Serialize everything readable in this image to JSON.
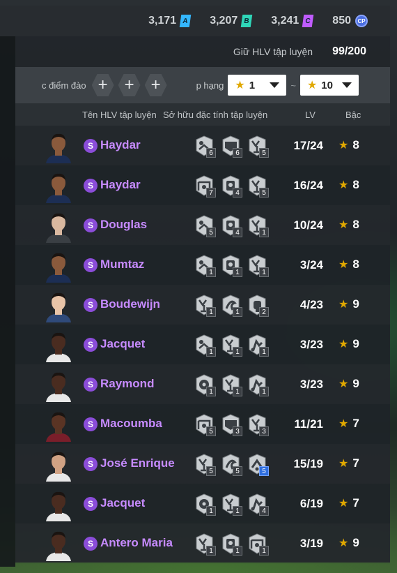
{
  "currencies": [
    {
      "value": "3,171",
      "badge": "A",
      "color": "#34b7ff",
      "icon": "a-currency-icon"
    },
    {
      "value": "3,207",
      "badge": "B",
      "color": "#2fd6b8",
      "icon": "b-currency-icon"
    },
    {
      "value": "3,241",
      "badge": "C",
      "color": "#c05cff",
      "icon": "c-currency-icon"
    },
    {
      "value": "850",
      "badge": "CP",
      "color": "#4c6fe0",
      "icon": "cp-currency-icon"
    }
  ],
  "hold": {
    "label": "Giữ HLV tập luyện",
    "value": "99/200"
  },
  "filters": {
    "trait_label": "c điểm đào",
    "rank_label": "p hạng",
    "rank_from": "1",
    "rank_to": "10",
    "tilde": "~"
  },
  "columns": {
    "name": "Tên HLV tập luyện",
    "traits": "Sở hữu đặc tính tập luyện",
    "lv": "LV",
    "grade": "Bậc"
  },
  "rows": [
    {
      "name": "Haydar",
      "lv": "17/24",
      "grade": "8",
      "skin": "#8a5a3c",
      "kit": "#1c2e54",
      "traits": [
        {
          "icon": "heading-trait-icon",
          "n": "6"
        },
        {
          "icon": "shield-trait-icon",
          "n": "6"
        },
        {
          "icon": "celebrate-trait-icon",
          "n": "5"
        }
      ]
    },
    {
      "name": "Haydar",
      "lv": "16/24",
      "grade": "8",
      "skin": "#8a5a3c",
      "kit": "#1c2e54",
      "traits": [
        {
          "icon": "goal-trait-icon",
          "n": "7"
        },
        {
          "icon": "save-trait-icon",
          "n": "4"
        },
        {
          "icon": "celebrate-trait-icon",
          "n": "5"
        }
      ]
    },
    {
      "name": "Douglas",
      "lv": "10/24",
      "grade": "8",
      "skin": "#d9b8a0",
      "kit": "#3a3f44",
      "traits": [
        {
          "icon": "heading-trait-icon",
          "n": "5"
        },
        {
          "icon": "save-trait-icon",
          "n": "4"
        },
        {
          "icon": "celebrate-trait-icon",
          "n": "1"
        }
      ]
    },
    {
      "name": "Mumtaz",
      "lv": "3/24",
      "grade": "8",
      "skin": "#8a5a3c",
      "kit": "#1c2e54",
      "traits": [
        {
          "icon": "heading-trait-icon",
          "n": "1"
        },
        {
          "icon": "save-trait-icon",
          "n": "1"
        },
        {
          "icon": "celebrate-trait-icon",
          "n": "1"
        }
      ]
    },
    {
      "name": "Boudewijn",
      "lv": "4/23",
      "grade": "9",
      "skin": "#e8c4a8",
      "kit": "#2f4a7a",
      "traits": [
        {
          "icon": "celebrate-trait-icon",
          "n": "1"
        },
        {
          "icon": "dribble-trait-icon",
          "n": "1"
        },
        {
          "icon": "fist-trait-icon",
          "n": "2"
        }
      ]
    },
    {
      "name": "Jacquet",
      "lv": "3/23",
      "grade": "9",
      "skin": "#4a2c20",
      "kit": "#e8e8e8",
      "traits": [
        {
          "icon": "heading-trait-icon",
          "n": "1"
        },
        {
          "icon": "celebrate-trait-icon",
          "n": "1"
        },
        {
          "icon": "tackle-trait-icon",
          "n": "1"
        }
      ]
    },
    {
      "name": "Raymond",
      "lv": "3/23",
      "grade": "9",
      "skin": "#4a2c20",
      "kit": "#e8e8e8",
      "traits": [
        {
          "icon": "ball-trait-icon",
          "n": "1"
        },
        {
          "icon": "celebrate-trait-icon",
          "n": "1"
        },
        {
          "icon": "tackle-trait-icon",
          "n": "1"
        }
      ]
    },
    {
      "name": "Macoumba",
      "lv": "11/21",
      "grade": "7",
      "skin": "#5a3424",
      "kit": "#7a1e2a",
      "traits": [
        {
          "icon": "goal-trait-icon",
          "n": "5"
        },
        {
          "icon": "shield-trait-icon",
          "n": "3"
        },
        {
          "icon": "celebrate-trait-icon",
          "n": "3"
        }
      ]
    },
    {
      "name": "José Enrique",
      "lv": "15/19",
      "grade": "7",
      "skin": "#d0a284",
      "kit": "#e8e8e8",
      "traits": [
        {
          "icon": "celebrate-trait-icon",
          "n": "5"
        },
        {
          "icon": "dribble-trait-icon",
          "n": "5"
        },
        {
          "icon": "pass-trait-icon",
          "n": "5",
          "blue": true
        }
      ]
    },
    {
      "name": "Jacquet",
      "lv": "6/19",
      "grade": "7",
      "skin": "#4a2c20",
      "kit": "#e8e8e8",
      "traits": [
        {
          "icon": "ball-trait-icon",
          "n": "1"
        },
        {
          "icon": "celebrate-trait-icon",
          "n": "1"
        },
        {
          "icon": "tackle-trait-icon",
          "n": "4"
        }
      ]
    },
    {
      "name": "Antero Maria",
      "lv": "3/19",
      "grade": "9",
      "skin": "#4a2c20",
      "kit": "#e8e8e8",
      "traits": [
        {
          "icon": "celebrate-trait-icon",
          "n": "1"
        },
        {
          "icon": "save-trait-icon",
          "n": "1"
        },
        {
          "icon": "goal-trait-icon",
          "n": "1"
        }
      ]
    }
  ]
}
